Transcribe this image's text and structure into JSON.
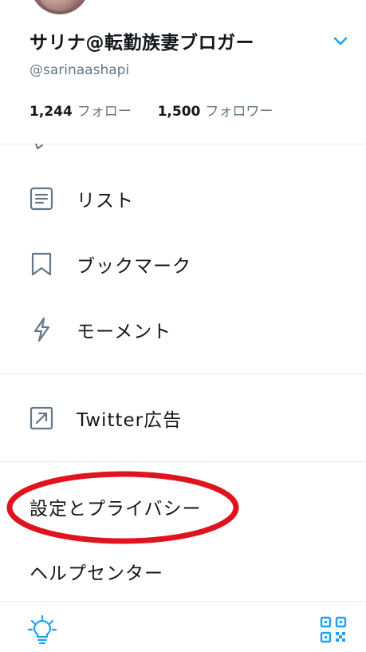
{
  "profile": {
    "display_name": "サリナ@転勤族妻ブロガー",
    "handle": "@sarinaashapi",
    "following_count": "1,244",
    "following_label": "フォロー",
    "followers_count": "1,500",
    "followers_label": "フォロワー"
  },
  "menu": {
    "lists_label": "リスト",
    "bookmarks_label": "ブックマーク",
    "moments_label": "モーメント",
    "ads_label": "Twitter広告",
    "settings_label": "設定とプライバシー",
    "help_label": "ヘルプセンター"
  },
  "colors": {
    "accent": "#1da1f2",
    "text": "#14171a",
    "secondary_text": "#657786",
    "divider": "#e6ecf0",
    "icon_gray": "#657786",
    "annotation_red": "#e0141e"
  },
  "icons": {
    "account_switch": "chevron-down-icon",
    "lists": "list-document-icon",
    "bookmarks": "bookmark-icon",
    "moments": "lightning-icon",
    "ads": "external-arrow-icon",
    "night_mode": "lightbulb-icon",
    "qr": "qr-code-icon"
  }
}
